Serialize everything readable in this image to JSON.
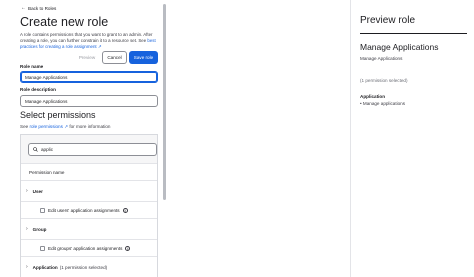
{
  "nav": {
    "back_label": "Back to Roles"
  },
  "form": {
    "title": "Create new role",
    "description": "A role contains permissions that you want to grant to an admin. After creating a role, you can further constrain it to a resource set. See",
    "description_link": "best practices for creating a role assignment",
    "preview_button": "Preview",
    "cancel_button": "Cancel",
    "save_button": "Save role",
    "role_name_label": "Role name",
    "role_name_value": "Manage Applications",
    "role_description_label": "Role description",
    "role_description_value": "Manage Applications"
  },
  "permissions": {
    "heading": "Select permissions",
    "see_prefix": "See",
    "see_link": "role permissions",
    "see_suffix": "for more information",
    "search_value": "applic",
    "column_header": "Permission name",
    "groups": [
      {
        "label": "User",
        "item": "Edit users' application assignments"
      },
      {
        "label": "Group",
        "item": "Edit groups' application assignments"
      },
      {
        "label": "Application",
        "count": "(1 permission selected)"
      }
    ]
  },
  "preview": {
    "title": "Preview role",
    "role_name": "Manage Applications",
    "role_description": "Manage Applications",
    "permission_count": "(1 permission selected)",
    "section": "Application",
    "items": [
      "Manage applications"
    ]
  },
  "colors": {
    "accent": "#1662dd",
    "text": "#1d1d21",
    "border": "#8d8f96"
  }
}
